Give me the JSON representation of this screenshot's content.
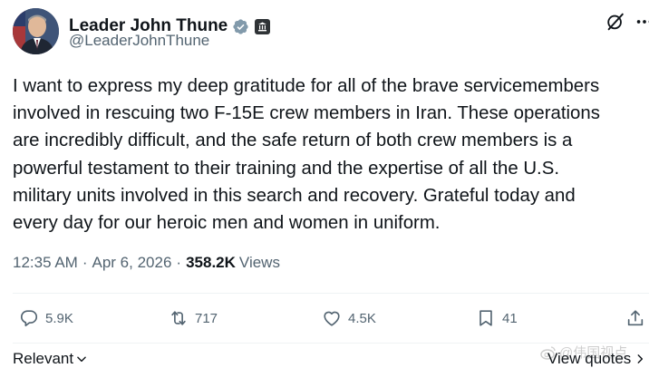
{
  "post": {
    "author": {
      "display_name": "Leader John Thune",
      "handle": "@LeaderJohnThune",
      "verified_icon": "verified-badge-icon",
      "affiliation_icon": "government-building-badge-icon"
    },
    "text": "I want to express my deep gratitude for all of the brave servicemembers\ninvolved in rescuing two F-15E crew members in Iran. These operations\nare incredibly difficult, and the safe return of both crew members is a\npowerful testament to their training and the expertise of all the U.S.\nmilitary units involved in this search and recovery. Grateful today and\nevery day for our heroic men and women in uniform.",
    "meta": {
      "time": "12:35 AM",
      "separator": "·",
      "date": "Apr 6, 2026",
      "views_count": "358.2K",
      "views_label": "Views"
    },
    "actions": {
      "replies": "5.9K",
      "reposts": "717",
      "likes": "4.5K",
      "bookmarks": "41"
    }
  },
  "footer": {
    "sort_label": "Relevant",
    "view_quotes_label": "View quotes"
  },
  "watermark": {
    "text": "@伟国视点"
  },
  "colors": {
    "text_primary": "#0f1419",
    "text_secondary": "#536471",
    "verified_blue": "#1d9bf0",
    "divider": "#eff3f4"
  }
}
